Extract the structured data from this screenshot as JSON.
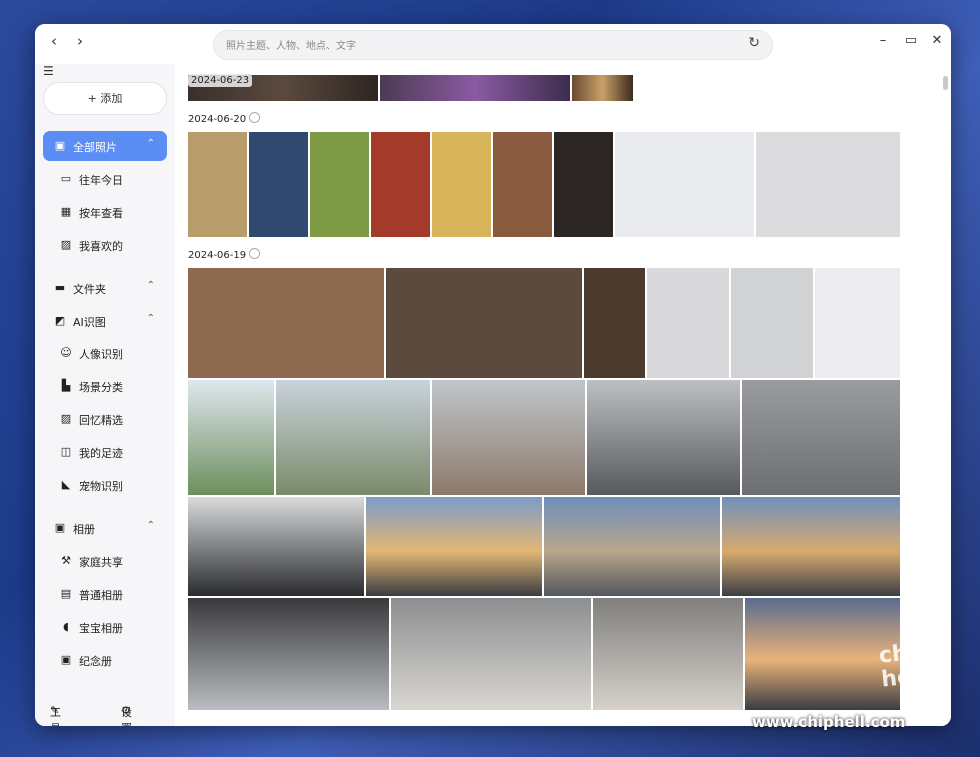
{
  "search": {
    "placeholder": "照片主题、人物、地点、文字"
  },
  "nav_glyphs": {
    "back": "‹",
    "forward": "›",
    "refresh": "↻",
    "collapse": "☰"
  },
  "window_controls": {
    "minimize": "–",
    "maximize": "▭",
    "close": "✕"
  },
  "sidebar": {
    "add_label": "添加",
    "add_glyph": "+",
    "items": [
      {
        "label": "全部照片",
        "icon": "image-icon",
        "glyph": "▣",
        "chev": "⌃",
        "active": true
      },
      {
        "label": "往年今日",
        "icon": "calendar-icon",
        "glyph": "▭"
      },
      {
        "label": "按年查看",
        "icon": "calendar-grid-icon",
        "glyph": "▦"
      },
      {
        "label": "我喜欢的",
        "icon": "heart-image-icon",
        "glyph": "▨"
      },
      {
        "label": "文件夹",
        "icon": "folder-icon",
        "glyph": "▬",
        "chev": "⌃"
      },
      {
        "label": "AI识图",
        "icon": "ai-image-icon",
        "glyph": "◩",
        "chev": "⌃"
      },
      {
        "label": "人像识别",
        "icon": "face-icon",
        "glyph": "☺"
      },
      {
        "label": "场景分类",
        "icon": "scene-icon",
        "glyph": "▙"
      },
      {
        "label": "回忆精选",
        "icon": "memory-icon",
        "glyph": "▨"
      },
      {
        "label": "我的足迹",
        "icon": "footprint-icon",
        "glyph": "◫"
      },
      {
        "label": "宠物识别",
        "icon": "pet-icon",
        "glyph": "◣"
      },
      {
        "label": "相册",
        "icon": "album-icon",
        "glyph": "▣",
        "chev": "⌃"
      },
      {
        "label": "家庭共享",
        "icon": "family-icon",
        "glyph": "⚒"
      },
      {
        "label": "普通相册",
        "icon": "album-normal-icon",
        "glyph": "▤"
      },
      {
        "label": "宝宝相册",
        "icon": "baby-icon",
        "glyph": "◖"
      },
      {
        "label": "纪念册",
        "icon": "memorial-icon",
        "glyph": "▣"
      }
    ],
    "tools_label": "工具箱",
    "tools_glyph": "✎",
    "settings_label": "设置",
    "settings_glyph": "⚙"
  },
  "groups": [
    {
      "date": "2024-06-23"
    },
    {
      "date": "2024-06-20"
    },
    {
      "date": "2024-06-19"
    }
  ],
  "watermark": {
    "text": "www.chiphell.com",
    "logo": "chip hell"
  }
}
